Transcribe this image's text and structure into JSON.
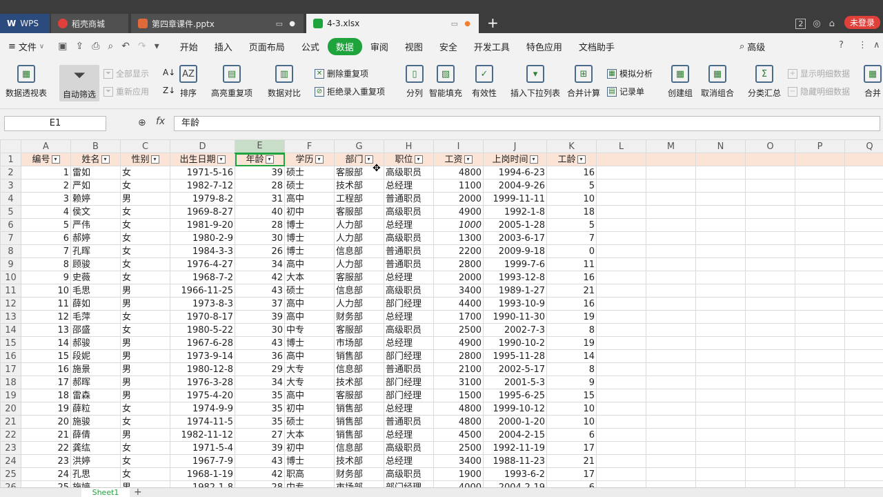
{
  "tabs": [
    {
      "label": "WPS"
    },
    {
      "label": "稻壳商城"
    },
    {
      "label": "第四章课件.pptx"
    },
    {
      "label": "4-3.xlsx"
    }
  ],
  "titlebar": {
    "window_count": "2",
    "login_label": "未登录"
  },
  "menu": {
    "file": "文件",
    "items": [
      "开始",
      "插入",
      "页面布局",
      "公式",
      "数据",
      "审阅",
      "视图",
      "安全",
      "开发工具",
      "特色应用",
      "文档助手"
    ],
    "active": "数据",
    "search_placeholder": "高级"
  },
  "ribbon": {
    "pivot": "数据透视表",
    "autofilter": "自动筛选",
    "show_all": "全部显示",
    "reapply": "重新应用",
    "sort": "排序",
    "highlight_dup": "高亮重复项",
    "compare": "数据对比",
    "remove_dup": "删除重复项",
    "reject_dup": "拒绝录入重复项",
    "split": "分列",
    "smart_fill": "智能填充",
    "validity": "有效性",
    "insert_dropdown": "插入下拉列表",
    "consolidate": "合并计算",
    "what_if": "模拟分析",
    "form": "记录单",
    "group": "创建组",
    "ungroup": "取消组合",
    "subtotal": "分类汇总",
    "show_detail": "显示明细数据",
    "hide_detail": "隐藏明细数据",
    "merge": "合并"
  },
  "formula": {
    "cell_ref": "E1",
    "fx": "fx",
    "content": "年龄"
  },
  "columns": [
    "A",
    "B",
    "C",
    "D",
    "E",
    "F",
    "G",
    "H",
    "I",
    "J",
    "K",
    "L",
    "M",
    "N",
    "O",
    "P",
    "Q"
  ],
  "headers": [
    "编号",
    "姓名",
    "性别",
    "出生日期",
    "年龄",
    "学历",
    "部门",
    "职位",
    "工资",
    "上岗时间",
    "工龄"
  ],
  "rows": [
    [
      "1",
      "雷如",
      "女",
      "1971-5-16",
      "39",
      "硕士",
      "客服部",
      "高级职员",
      "4800",
      "1994-6-23",
      "16"
    ],
    [
      "2",
      "严如",
      "女",
      "1982-7-12",
      "28",
      "硕士",
      "技术部",
      "总经理",
      "1100",
      "2004-9-26",
      "5"
    ],
    [
      "3",
      "赖婷",
      "男",
      "1979-8-2",
      "31",
      "高中",
      "工程部",
      "普通职员",
      "2000",
      "1999-11-11",
      "10"
    ],
    [
      "4",
      "侯文",
      "女",
      "1969-8-27",
      "40",
      "初中",
      "客服部",
      "高级职员",
      "4900",
      "1992-1-8",
      "18"
    ],
    [
      "5",
      "严伟",
      "女",
      "1981-9-20",
      "28",
      "博士",
      "人力部",
      "总经理",
      "1000",
      "2005-1-28",
      "5"
    ],
    [
      "6",
      "郝婷",
      "女",
      "1980-2-9",
      "30",
      "博士",
      "人力部",
      "高级职员",
      "1300",
      "2003-6-17",
      "7"
    ],
    [
      "7",
      "孔晖",
      "女",
      "1984-3-3",
      "26",
      "博士",
      "信息部",
      "普通职员",
      "2200",
      "2009-9-18",
      "0"
    ],
    [
      "8",
      "顾骏",
      "女",
      "1976-4-27",
      "34",
      "高中",
      "人力部",
      "普通职员",
      "2800",
      "1999-7-6",
      "11"
    ],
    [
      "9",
      "史薇",
      "女",
      "1968-7-2",
      "42",
      "大本",
      "客服部",
      "总经理",
      "2000",
      "1993-12-8",
      "16"
    ],
    [
      "10",
      "毛思",
      "男",
      "1966-11-25",
      "43",
      "硕士",
      "信息部",
      "高级职员",
      "3400",
      "1989-1-27",
      "21"
    ],
    [
      "11",
      "薛如",
      "男",
      "1973-8-3",
      "37",
      "高中",
      "人力部",
      "部门经理",
      "4400",
      "1993-10-9",
      "16"
    ],
    [
      "12",
      "毛萍",
      "女",
      "1970-8-17",
      "39",
      "高中",
      "财务部",
      "总经理",
      "1700",
      "1990-11-30",
      "19"
    ],
    [
      "13",
      "邵盛",
      "女",
      "1980-5-22",
      "30",
      "中专",
      "客服部",
      "高级职员",
      "2500",
      "2002-7-3",
      "8"
    ],
    [
      "14",
      "郝骏",
      "男",
      "1967-6-28",
      "43",
      "博士",
      "市场部",
      "总经理",
      "4900",
      "1990-10-2",
      "19"
    ],
    [
      "15",
      "段妮",
      "男",
      "1973-9-14",
      "36",
      "高中",
      "销售部",
      "部门经理",
      "2800",
      "1995-11-28",
      "14"
    ],
    [
      "16",
      "施景",
      "男",
      "1980-12-8",
      "29",
      "大专",
      "信息部",
      "普通职员",
      "2100",
      "2002-5-17",
      "8"
    ],
    [
      "17",
      "郝晖",
      "男",
      "1976-3-28",
      "34",
      "大专",
      "技术部",
      "部门经理",
      "3100",
      "2001-5-3",
      "9"
    ],
    [
      "18",
      "雷森",
      "男",
      "1975-4-20",
      "35",
      "高中",
      "客服部",
      "部门经理",
      "1500",
      "1995-6-25",
      "15"
    ],
    [
      "19",
      "薛粒",
      "女",
      "1974-9-9",
      "35",
      "初中",
      "销售部",
      "总经理",
      "4800",
      "1999-10-12",
      "10"
    ],
    [
      "20",
      "施骏",
      "女",
      "1974-11-5",
      "35",
      "硕士",
      "销售部",
      "普通职员",
      "4800",
      "2000-1-20",
      "10"
    ],
    [
      "21",
      "薛倩",
      "男",
      "1982-11-12",
      "27",
      "大本",
      "销售部",
      "总经理",
      "4500",
      "2004-2-15",
      "6"
    ],
    [
      "22",
      "龚纮",
      "女",
      "1971-5-4",
      "39",
      "初中",
      "信息部",
      "高级职员",
      "2500",
      "1992-11-19",
      "17"
    ],
    [
      "23",
      "洪婷",
      "女",
      "1967-7-9",
      "43",
      "博士",
      "技术部",
      "总经理",
      "3400",
      "1988-11-23",
      "21"
    ],
    [
      "24",
      "孔思",
      "女",
      "1968-1-19",
      "42",
      "职高",
      "财务部",
      "高级职员",
      "1900",
      "1993-6-2",
      "17"
    ],
    [
      "25",
      "施婷",
      "男",
      "1982-1-8",
      "28",
      "中专",
      "市场部",
      "部门经理",
      "4000",
      "2004-2-19",
      "6"
    ]
  ],
  "sheet_tab": "Sheet1"
}
